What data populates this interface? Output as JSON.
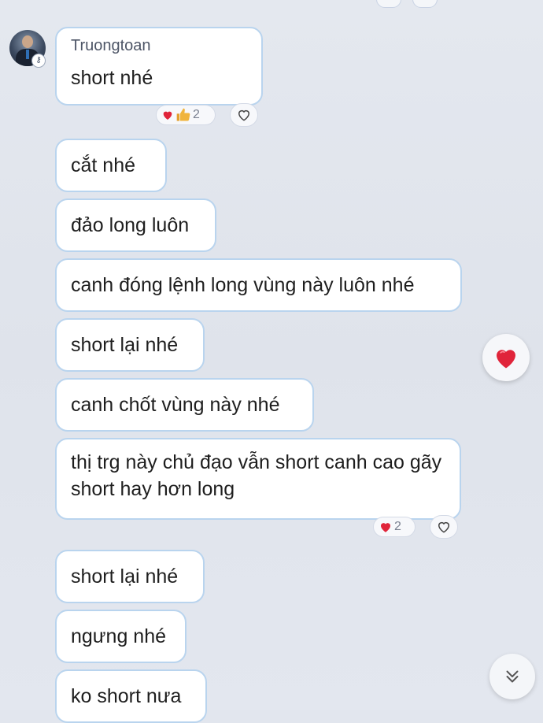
{
  "conversation": {
    "sender": "Truongtoan",
    "messages": [
      {
        "text": "short nhé"
      },
      {
        "text": "cắt nhé"
      },
      {
        "text": "đảo long luôn"
      },
      {
        "text": "canh đóng lệnh long vùng này luôn nhé"
      },
      {
        "text": "short lại nhé"
      },
      {
        "text": "canh chốt vùng này nhé"
      },
      {
        "text": "thị trg này chủ đạo vẫn short canh cao gãy short hay hơn long"
      },
      {
        "text": "short lại nhé"
      },
      {
        "text": "ngưng nhé"
      },
      {
        "text": "ko short nưa"
      }
    ],
    "reactions": [
      {
        "icons": [
          "heart-icon",
          "thumbs-up-icon"
        ],
        "count": "2"
      },
      {
        "icons": [
          "heart-icon"
        ],
        "count": "2"
      }
    ]
  },
  "colors": {
    "bubble_border": "#b9d4ee",
    "heart": "#e0243a",
    "thumb": "#f0b43c"
  }
}
